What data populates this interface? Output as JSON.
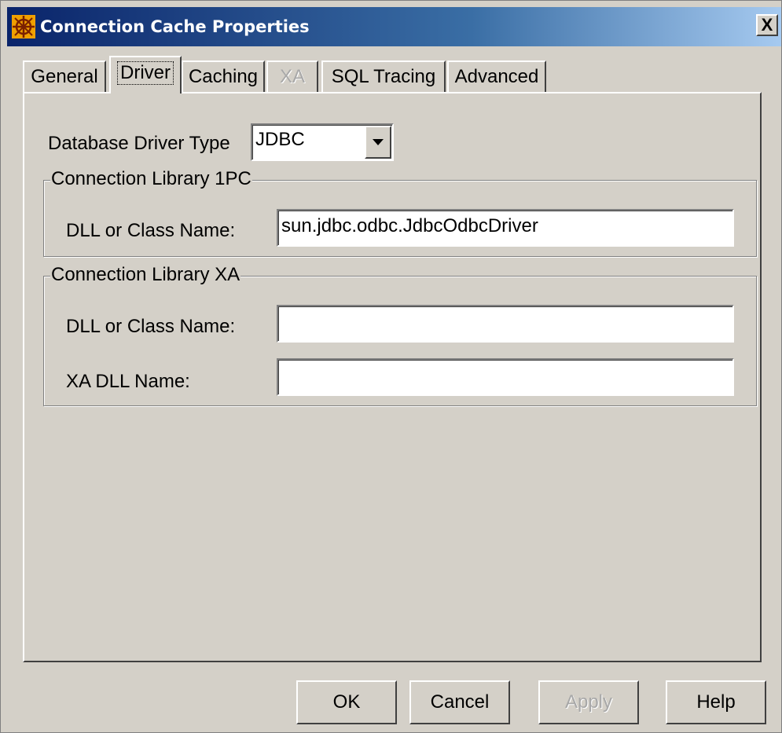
{
  "window": {
    "title": "Connection Cache Properties",
    "close_glyph": "X",
    "app_icon": "connection-cache-icon"
  },
  "tabs": [
    {
      "label": "General",
      "active": false,
      "disabled": false
    },
    {
      "label": "Driver",
      "active": true,
      "disabled": false
    },
    {
      "label": "Caching",
      "active": false,
      "disabled": false
    },
    {
      "label": "XA",
      "active": false,
      "disabled": true
    },
    {
      "label": "SQL Tracing",
      "active": false,
      "disabled": false
    },
    {
      "label": "Advanced",
      "active": false,
      "disabled": false
    }
  ],
  "driver": {
    "type_label": "Database Driver Type",
    "type_value": "JDBC"
  },
  "library_1pc": {
    "title": "Connection Library 1PC",
    "class_label": "DLL or Class Name:",
    "class_value": "sun.jdbc.odbc.JdbcOdbcDriver"
  },
  "library_xa": {
    "title": "Connection Library XA",
    "class_label": "DLL or Class Name:",
    "class_value": "",
    "xa_dll_label": "XA DLL Name:",
    "xa_dll_value": ""
  },
  "buttons": {
    "ok": "OK",
    "cancel": "Cancel",
    "apply": "Apply",
    "help": "Help"
  },
  "colors": {
    "title_gradient_start": "#0a246a",
    "title_gradient_end": "#a6caf0",
    "dialog_face": "#d4d0c8"
  }
}
